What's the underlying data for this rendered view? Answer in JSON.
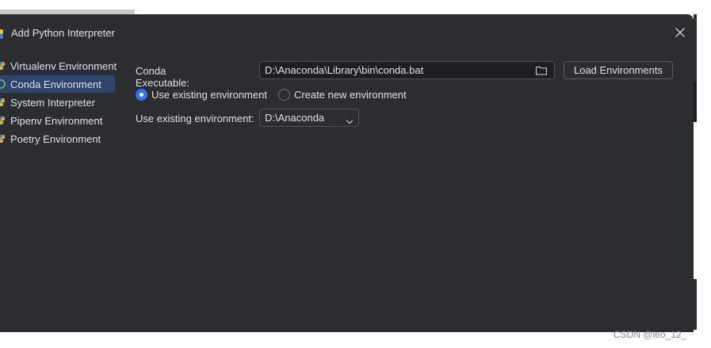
{
  "dialog": {
    "title": "Add Python Interpreter",
    "close_icon": "close-icon"
  },
  "sidebar": {
    "items": [
      {
        "label": "Virtualenv Environment",
        "icon": "python-icon",
        "selected": false
      },
      {
        "label": "Conda Environment",
        "icon": "conda-icon",
        "selected": true
      },
      {
        "label": "System Interpreter",
        "icon": "python-icon",
        "selected": false
      },
      {
        "label": "Pipenv Environment",
        "icon": "python-icon",
        "selected": false
      },
      {
        "label": "Poetry Environment",
        "icon": "python-icon",
        "selected": false
      }
    ]
  },
  "conda": {
    "executable_label": "Conda Executable:",
    "executable_value": "D:\\Anaconda\\Library\\bin\\conda.bat",
    "load_button": "Load Environments",
    "radio_existing": "Use existing environment",
    "radio_new": "Create new environment",
    "radio_existing_checked": true,
    "existing_label": "Use existing environment:",
    "existing_value": "D:\\Anaconda"
  },
  "watermark": "CSDN @leo_12_",
  "colors": {
    "dialog_bg": "#2b2d30",
    "selected_bg": "#2e436e",
    "accent": "#3574f0",
    "field_bg": "#1e1f22",
    "text": "#dfe1e5"
  }
}
